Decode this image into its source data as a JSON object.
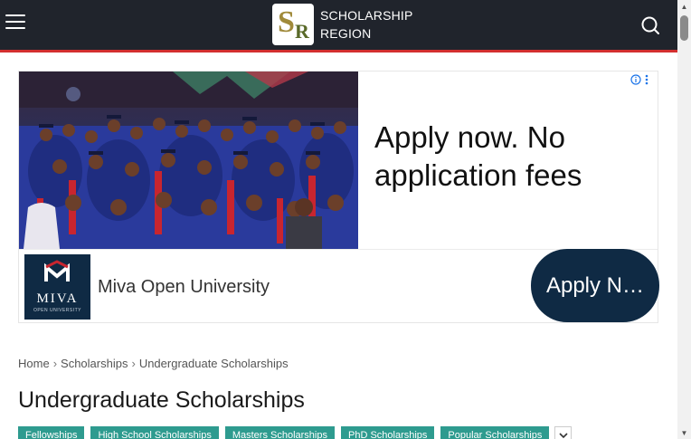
{
  "header": {
    "menu_icon": "hamburger-menu-icon",
    "logo_mark_s": "S",
    "logo_mark_r": "R",
    "logo_line1": "SCHOLARSHIP",
    "logo_line2": "REGION",
    "search_icon": "search-icon"
  },
  "ad": {
    "headline": "Apply now. No application fees",
    "advertiser": "Miva Open University",
    "advertiser_logo_word": "MIVA",
    "advertiser_logo_sub": "OPEN UNIVERSITY",
    "cta_label": "Apply N…",
    "info_icon": "ad-info-icon",
    "more_icon": "ad-options-icon"
  },
  "breadcrumb": {
    "items": [
      "Home",
      "Scholarships",
      "Undergraduate Scholarships"
    ],
    "separator": "›"
  },
  "page_title": "Undergraduate Scholarships",
  "categories": {
    "items": [
      "Fellowships",
      "High School Scholarships",
      "Masters Scholarships",
      "PhD Scholarships",
      "Popular Scholarships"
    ],
    "toggle_icon": "chevron-down-icon"
  },
  "colors": {
    "header_bg": "#20242c",
    "header_rule": "#d32f2f",
    "chip_bg": "#2e9b8f",
    "ad_cta_bg": "#0f2a44"
  }
}
